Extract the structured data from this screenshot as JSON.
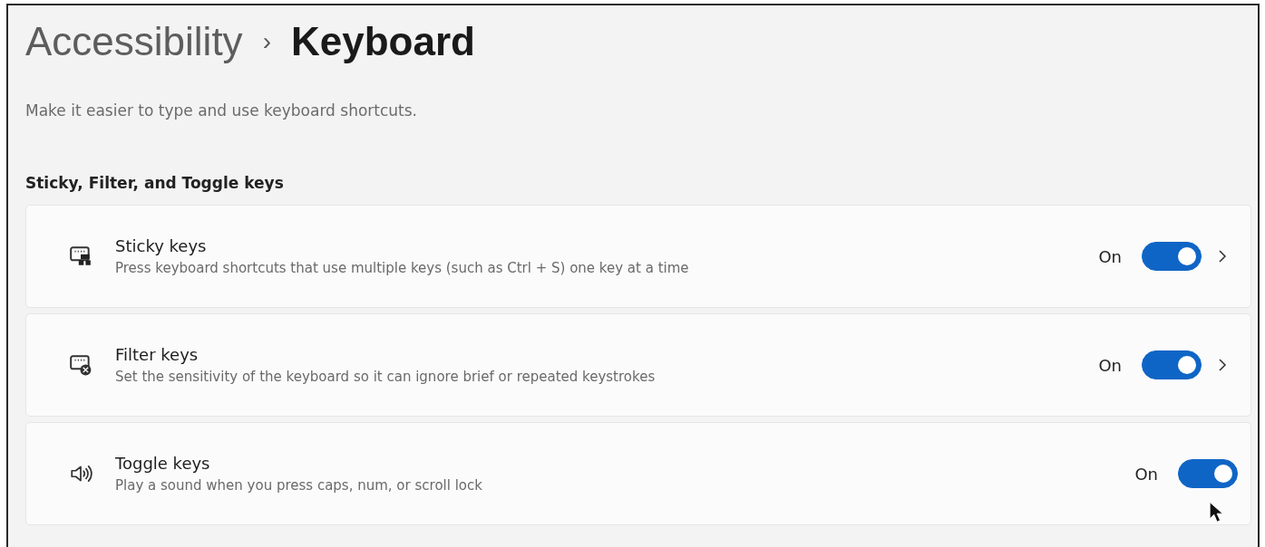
{
  "breadcrumb": {
    "parent": "Accessibility",
    "separator": "›",
    "current": "Keyboard"
  },
  "description": "Make it easier to type and use keyboard shortcuts.",
  "section": {
    "title": "Sticky, Filter, and Toggle keys",
    "settings": [
      {
        "title": "Sticky keys",
        "description": "Press keyboard shortcuts that use multiple keys (such as Ctrl + S) one key at a time",
        "state_label": "On",
        "on": true,
        "chevron": true
      },
      {
        "title": "Filter keys",
        "description": "Set the sensitivity of the keyboard so it can ignore brief or repeated keystrokes",
        "state_label": "On",
        "on": true,
        "chevron": true
      },
      {
        "title": "Toggle keys",
        "description": "Play a sound when you press caps, num, or scroll lock",
        "state_label": "On",
        "on": true,
        "chevron": false
      }
    ]
  }
}
